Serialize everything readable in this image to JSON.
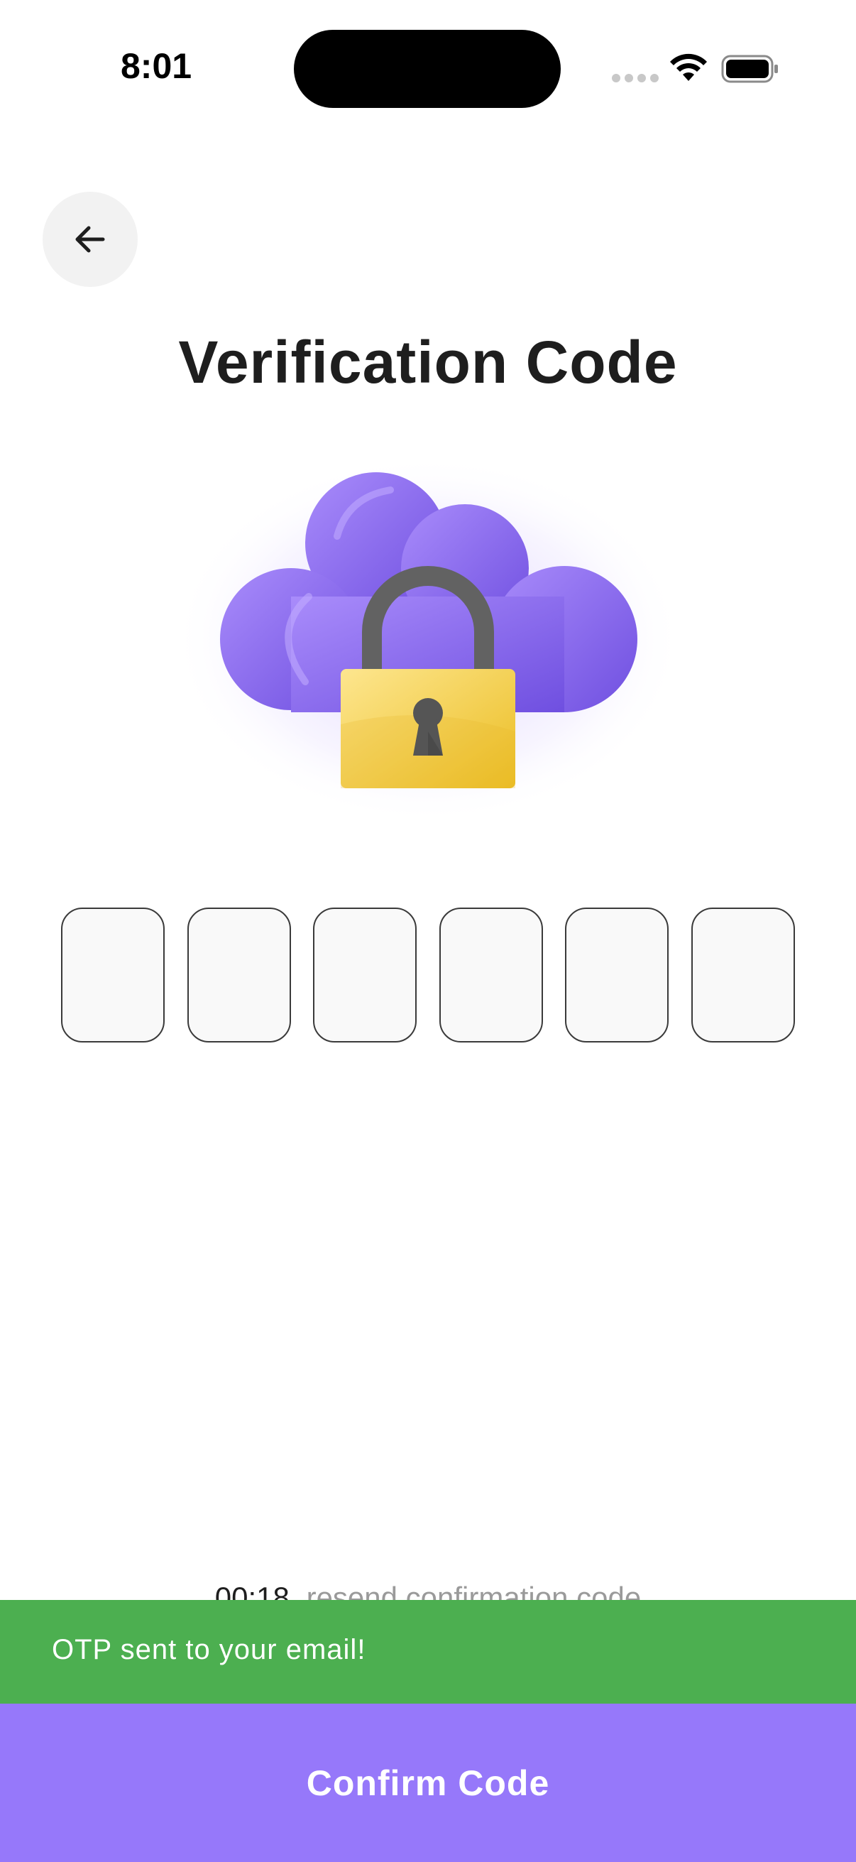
{
  "status_bar": {
    "time": "8:01",
    "icons": [
      "signal-dots-icon",
      "wifi-icon",
      "battery-icon"
    ]
  },
  "header": {
    "back_icon": "arrow-left-icon",
    "title": "Verification Code"
  },
  "hero": {
    "illustration": "cloud-lock-illustration",
    "colors": {
      "cloud": "#8f6cf0",
      "lock_body": "#f3cd3a",
      "shackle": "#626262"
    }
  },
  "otp": {
    "digits": [
      "",
      "",
      "",
      "",
      "",
      ""
    ]
  },
  "resend": {
    "timer": "00:18",
    "link": "resend confirmation code"
  },
  "snackbar": {
    "message": "OTP sent to your email!",
    "color": "#4caf50"
  },
  "confirm": {
    "label": "Confirm Code",
    "color": "#9678fa"
  }
}
